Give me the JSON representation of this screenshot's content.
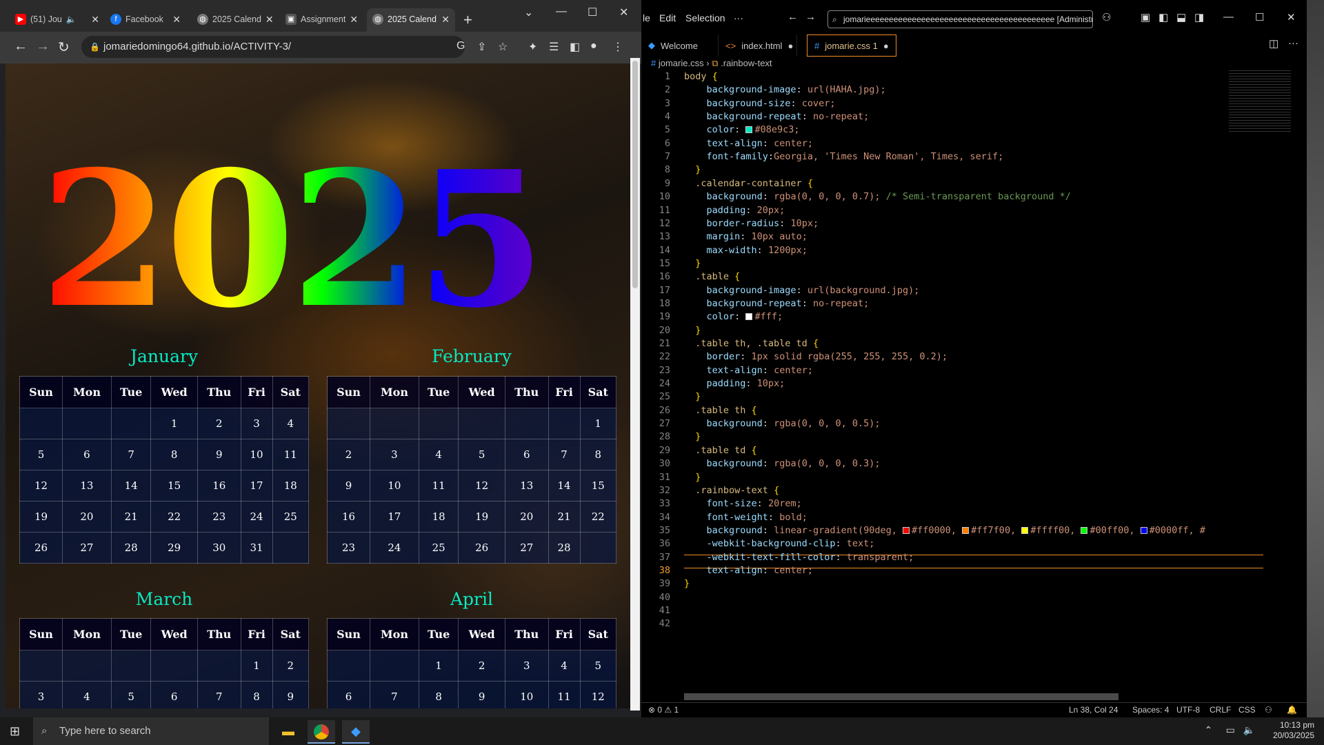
{
  "browser": {
    "tabs": [
      {
        "title": "(51) Jou",
        "icon": "youtube-icon",
        "color": "#ff0000"
      },
      {
        "title": "Facebook",
        "icon": "facebook-icon",
        "color": "#1877f2"
      },
      {
        "title": "2025 Calend",
        "icon": "globe-icon",
        "color": "#888888"
      },
      {
        "title": "Assignment",
        "icon": "classroom-icon",
        "color": "#888888"
      },
      {
        "title": "2025 Calend",
        "icon": "globe-icon",
        "color": "#888888"
      }
    ],
    "url": "jomariedomingo64.github.io/ACTIVITY-3/"
  },
  "page": {
    "year": "2025",
    "weekdays": [
      "Sun",
      "Mon",
      "Tue",
      "Wed",
      "Thu",
      "Fri",
      "Sat"
    ],
    "months": [
      {
        "name": "January",
        "rows": [
          [
            "",
            "",
            "",
            "1",
            "2",
            "3",
            "4"
          ],
          [
            "5",
            "6",
            "7",
            "8",
            "9",
            "10",
            "11"
          ],
          [
            "12",
            "13",
            "14",
            "15",
            "16",
            "17",
            "18"
          ],
          [
            "19",
            "20",
            "21",
            "22",
            "23",
            "24",
            "25"
          ],
          [
            "26",
            "27",
            "28",
            "29",
            "30",
            "31",
            ""
          ]
        ]
      },
      {
        "name": "February",
        "rows": [
          [
            "",
            "",
            "",
            "",
            "",
            "",
            "1"
          ],
          [
            "2",
            "3",
            "4",
            "5",
            "6",
            "7",
            "8"
          ],
          [
            "9",
            "10",
            "11",
            "12",
            "13",
            "14",
            "15"
          ],
          [
            "16",
            "17",
            "18",
            "19",
            "20",
            "21",
            "22"
          ],
          [
            "23",
            "24",
            "25",
            "26",
            "27",
            "28",
            ""
          ]
        ]
      },
      {
        "name": "March",
        "rows": [
          [
            "",
            "",
            "",
            "",
            "",
            "1",
            "2"
          ],
          [
            "3",
            "4",
            "5",
            "6",
            "7",
            "8",
            "9"
          ]
        ]
      },
      {
        "name": "April",
        "rows": [
          [
            "",
            "",
            "1",
            "2",
            "3",
            "4",
            "5"
          ],
          [
            "6",
            "7",
            "8",
            "9",
            "10",
            "11",
            "12"
          ]
        ]
      }
    ]
  },
  "vscode": {
    "menu": [
      "le",
      "Edit",
      "Selection",
      "···"
    ],
    "search": "jomarieeeeeeeeeeeeeeeeeeeeeeeeeeeeeeeeeeeeeeeee [Administrator]",
    "tabs": [
      {
        "label": "Welcome",
        "icon": "vscode-icon"
      },
      {
        "label": "index.html",
        "icon": "html-icon",
        "dirty": "●"
      },
      {
        "label": "jomarie.css 1",
        "icon": "css-icon",
        "dirty": "●"
      }
    ],
    "breadcrumb": [
      "jomarie.css",
      ".rainbow-text"
    ],
    "lines": [
      "body {",
      "    background-image: url(HAHA.jpg);",
      "    background-size: cover;",
      "    background-repeat: no-repeat;",
      "    color: #08e9c3;",
      "    text-align: center;",
      "    font-family:Georgia, 'Times New Roman', Times, serif;",
      "  }",
      "  .calendar-container {",
      "    background: rgba(0, 0, 0, 0.7); /* Semi-transparent background */",
      "    padding: 20px;",
      "    border-radius: 10px;",
      "    margin: 10px auto;",
      "    max-width: 1200px;",
      "  }",
      "  .table {",
      "    background-image: url(background.jpg);",
      "    background-repeat: no-repeat;",
      "    color: #fff;",
      "  }",
      "  .table th, .table td {",
      "    border: 1px solid rgba(255, 255, 255, 0.2);",
      "    text-align: center;",
      "    padding: 10px;",
      "  }",
      "  .table th {",
      "    background: rgba(0, 0, 0, 0.5);",
      "  }",
      "  .table td {",
      "    background: rgba(0, 0, 0, 0.3);",
      "  }",
      "  .rainbow-text {",
      "    font-size: 20rem;",
      "    font-weight: bold;",
      "    background: linear-gradient(90deg, #ff0000, #ff7f00, #ffff00, #00ff00, #0000ff, #",
      "    -webkit-background-clip: text;",
      "    -webkit-text-fill-color: transparent;",
      "    text-align: center;",
      "}",
      "",
      "",
      ""
    ],
    "status": {
      "problems": "⊗ 0 ⚠ 1",
      "position": "Ln 38, Col 24",
      "spaces": "Spaces: 4",
      "encoding": "UTF-8",
      "eol": "CRLF",
      "language": "CSS"
    }
  },
  "taskbar": {
    "search_placeholder": "Type here to search",
    "time": "10:13 pm",
    "date": "20/03/2025"
  }
}
